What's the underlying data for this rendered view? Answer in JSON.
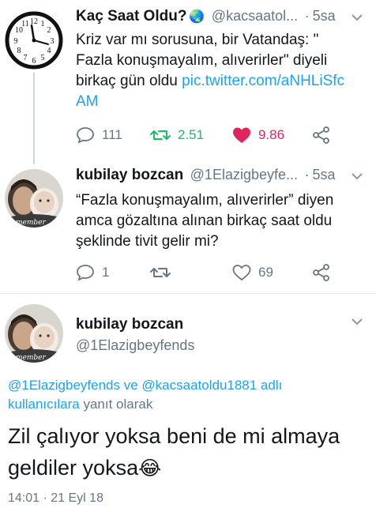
{
  "tweet1": {
    "name": "Kaç Saat Oldu?",
    "globe": "🌏",
    "handle": "@kacsaatol...",
    "dot": "·",
    "time": "5sa",
    "text": "Kriz var mı sorusuna, bir Vatandaş: \" Fazla konuşmayalım, alıverirler\" diyeli birkaç gün oldu",
    "link": "pic.twitter.com/aNHLiSfcAM",
    "replies": "111",
    "retweets": "2.51",
    "likes": "9.86",
    "retweet_color": "#17bf63",
    "like_color": "#e0245e"
  },
  "tweet2": {
    "name": "kubilay bozcan",
    "handle": "@1Elazigbeyfe...",
    "dot": "·",
    "time": "5sa",
    "text": "“Fazla konuşmayalım, alıverirler” diyen amca gözaltına alınan birkaç saat oldu şeklinde tivit gelir mi?",
    "replies": "1",
    "likes": "69"
  },
  "tweet3": {
    "name": "kubilay bozcan",
    "handle": "@1Elazigbeyfends",
    "reply_to_mentions": "@1Elazigbeyfends ve @kacsaatoldu1881 adlı kullanıcılara",
    "reply_to_suffix": "yanıt olarak",
    "text": "Zil çalıyor yoksa beni de mi almaya geldiler yoksa",
    "emoji": "😂",
    "timestamp": "14:01 · 21 Eyl 18"
  },
  "avatar_watermark": "member",
  "clock_numbers": [
    "12",
    "1",
    "2",
    "3",
    "4",
    "5",
    "6",
    "7",
    "8",
    "9",
    "10",
    "11"
  ],
  "colors": {
    "link": "#1da1f2",
    "secondary": "#657786",
    "thread_line": "#ccd6dd"
  }
}
